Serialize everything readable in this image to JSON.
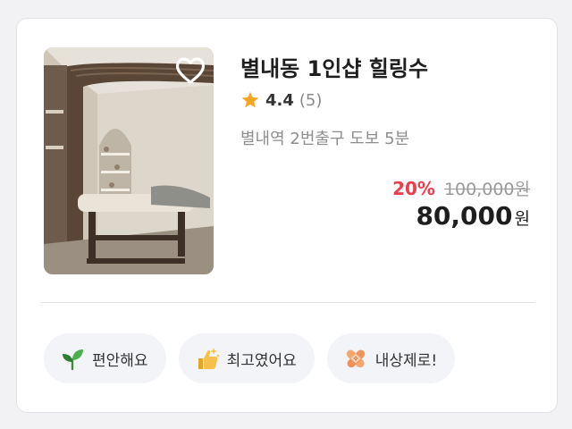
{
  "listing": {
    "title": "별내동 1인샵 힐링수",
    "rating": {
      "icon": "star-icon",
      "score": "4.4",
      "count": "(5)",
      "color": "#f6a623"
    },
    "location": "별내역 2번출구 도보 5분",
    "favorite_icon": "heart-outline-icon",
    "price": {
      "discount": "20%",
      "original": "100,000원",
      "final": "80,000",
      "currency": "원",
      "discount_color": "#ef3d4c"
    }
  },
  "tags": [
    {
      "label": "편안해요",
      "icon": "leaf-sprout-icon"
    },
    {
      "label": "최고였어요",
      "icon": "thumbs-up-sparkle-icon"
    },
    {
      "label": "내상제로!",
      "icon": "bandage-icon"
    }
  ]
}
